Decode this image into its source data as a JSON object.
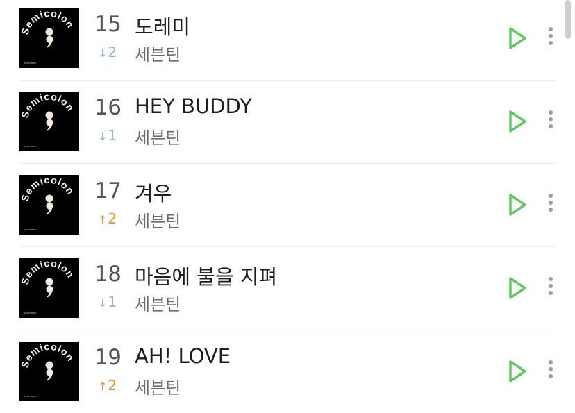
{
  "colors": {
    "accent_play": "#5cc85c",
    "rank_down": "#8ab4e8",
    "rank_up": "#e7922e",
    "more_dots": "#9a9a9a"
  },
  "cover_art": {
    "text": "Semicolon",
    "small_text": "seventeen"
  },
  "songs": [
    {
      "rank": "15",
      "title": "도레미",
      "change": "2",
      "direction": "down",
      "arrow": "↓",
      "artist": "세븐틴"
    },
    {
      "rank": "16",
      "title": "HEY BUDDY",
      "change": "1",
      "direction": "down",
      "arrow": "↓",
      "artist": "세븐틴"
    },
    {
      "rank": "17",
      "title": "겨우",
      "change": "2",
      "direction": "up",
      "arrow": "↑",
      "artist": "세븐틴"
    },
    {
      "rank": "18",
      "title": "마음에 불을 지펴",
      "change": "1",
      "direction": "down",
      "arrow": "↓",
      "artist": "세븐틴"
    },
    {
      "rank": "19",
      "title": "AH! LOVE",
      "change": "2",
      "direction": "up",
      "arrow": "↑",
      "artist": "세븐틴"
    }
  ]
}
